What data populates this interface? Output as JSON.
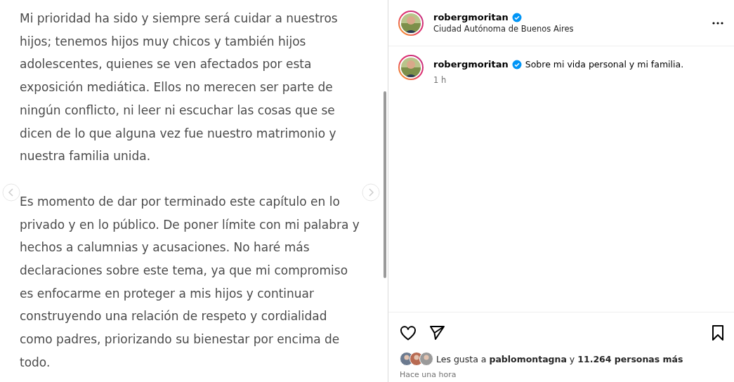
{
  "post_image": {
    "paragraphs": [
      [
        "Mi prioridad ha sido y siempre será cuidar a nuestros",
        "hijos; tenemos hijos muy chicos y también hijos",
        "adolescentes, quienes se ven afectados por esta",
        "exposición mediática. Ellos no merecen ser parte de",
        "ningún conflicto, ni leer ni escuchar las cosas que se",
        "dicen de lo que alguna vez fue nuestro matrimonio y",
        "nuestra familia unida."
      ],
      [
        "Es momento de dar por terminado este capítulo en lo",
        "privado y en lo público. De poner límite con mi palabra y",
        "hechos a calumnias y acusaciones. No haré más",
        "declaraciones sobre este tema, ya que mi compromiso",
        "es enfocarme en proteger a mis hijos y continuar",
        "construyendo una relación de respeto y cordialidad",
        "como padres, priorizando su bienestar por encima de",
        "todo."
      ]
    ]
  },
  "header": {
    "username": "robergmoritan",
    "verified": true,
    "location": "Ciudad Autónoma de Buenos Aires"
  },
  "caption": {
    "username": "robergmoritan",
    "verified": true,
    "text": "Sobre mi vida personal y mi familia.",
    "time": "1 h"
  },
  "likes": {
    "prefix": "Les gusta a",
    "user": "pablomontagna",
    "middle": "y",
    "count": "11.264 personas más"
  },
  "timestamp": "Hace una hora"
}
